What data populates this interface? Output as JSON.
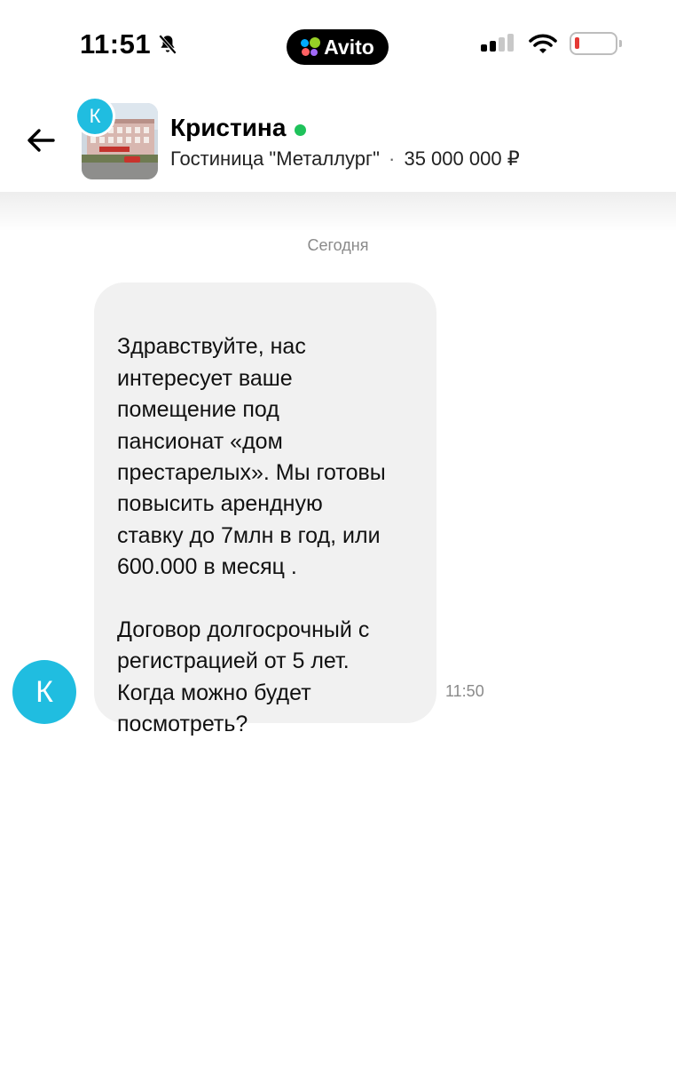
{
  "status_bar": {
    "time": "11:51",
    "app_badge": "Avito",
    "battery_color": "#e53935"
  },
  "header": {
    "avatar_letter": "К",
    "contact_name": "Кристина",
    "online_color": "#1fc25b",
    "listing_title": "Гостиница \"Металлург\"",
    "separator": "·",
    "listing_price": "35 000 000 ₽",
    "accent_color": "#20bde0"
  },
  "chat": {
    "date_label": "Сегодня",
    "messages": [
      {
        "sender_letter": "К",
        "text": "Здравствуйте, нас\nинтересует ваше\nпомещение под\nпансионат «дом\nпрестарелых». Мы готовы\nповысить арендную\nставку до 7млн в год, или\n600.000 в месяц .\n\nДоговор долгосрочный с\nрегистрацией от 5 лет.\nКогда можно будет\nпосмотреть?",
        "time": "11:50"
      }
    ]
  }
}
